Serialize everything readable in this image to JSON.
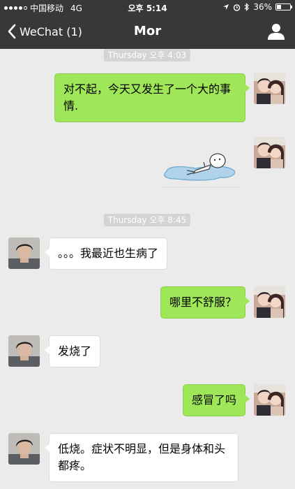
{
  "status": {
    "carrier": "中国移动",
    "network": "4G",
    "time": "오후 5:14",
    "battery_text": "36%",
    "battery_level": 0.36
  },
  "nav": {
    "back_label": "WeChat (1)",
    "title": "Mor"
  },
  "messages": {
    "ts1": "Thursday 오후 4:03",
    "m1": "对不起，今天又发生了一个大的事情.",
    "ts2": "Thursday 오후 8:45",
    "m3": "。。。我最近也生病了",
    "m4": "哪里不舒服？",
    "m5": "发烧了",
    "m6": "感冒了吗",
    "m7": "低烧。症状不明显，但是身体和头都疼。"
  },
  "colors": {
    "bar": "#383838",
    "my_bubble": "#9fe658",
    "their_bubble": "#ffffff",
    "background": "#ebebeb"
  }
}
